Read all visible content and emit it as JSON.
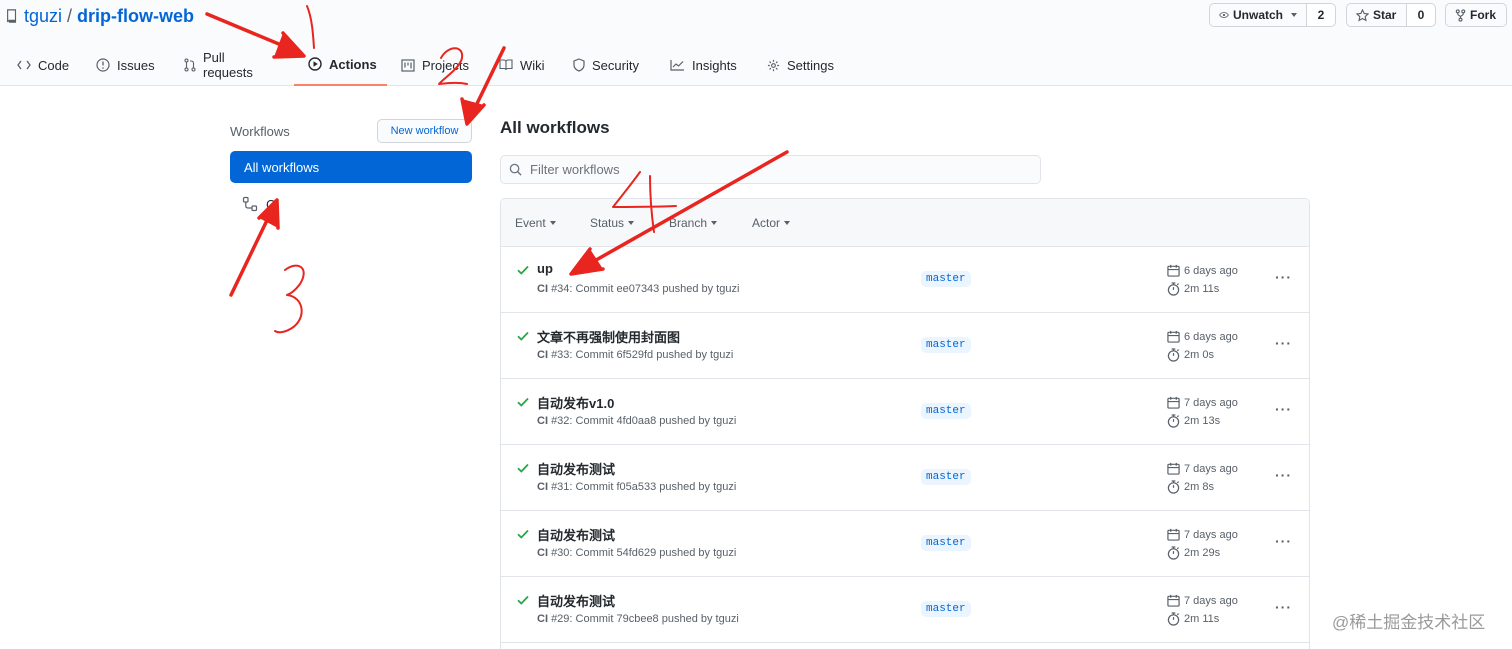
{
  "repo": {
    "owner": "tguzi",
    "separator": "/",
    "name": "drip-flow-web"
  },
  "social": {
    "watch_label": "Unwatch",
    "watch_count": "2",
    "star_label": "Star",
    "star_count": "0",
    "fork_label": "Fork"
  },
  "tabs": [
    {
      "label": "Code",
      "icon": "code-icon"
    },
    {
      "label": "Issues",
      "icon": "issue-icon"
    },
    {
      "label": "Pull requests",
      "icon": "pull-request-icon"
    },
    {
      "label": "Actions",
      "icon": "play-icon",
      "active": true
    },
    {
      "label": "Projects",
      "icon": "project-icon"
    },
    {
      "label": "Wiki",
      "icon": "book-icon"
    },
    {
      "label": "Security",
      "icon": "shield-icon"
    },
    {
      "label": "Insights",
      "icon": "graph-icon"
    },
    {
      "label": "Settings",
      "icon": "gear-icon"
    }
  ],
  "sidebar": {
    "heading": "Workflows",
    "new_workflow": "New workflow",
    "items": [
      {
        "label": "All workflows",
        "selected": true
      },
      {
        "label": "CI",
        "icon": "workflow-icon"
      }
    ]
  },
  "main": {
    "title": "All workflows",
    "filter_placeholder": "Filter workflows",
    "filters": [
      "Event",
      "Status",
      "Branch",
      "Actor"
    ],
    "runs": [
      {
        "title": "up",
        "workflow": "CI",
        "meta": "#34: Commit ee07343 pushed by tguzi",
        "branch": "master",
        "date": "6 days ago",
        "duration": "2m 11s"
      },
      {
        "title": "文章不再强制使用封面图",
        "workflow": "CI",
        "meta": "#33: Commit 6f529fd pushed by tguzi",
        "branch": "master",
        "date": "6 days ago",
        "duration": "2m 0s"
      },
      {
        "title": "自动发布v1.0",
        "workflow": "CI",
        "meta": "#32: Commit 4fd0aa8 pushed by tguzi",
        "branch": "master",
        "date": "7 days ago",
        "duration": "2m 13s"
      },
      {
        "title": "自动发布测试",
        "workflow": "CI",
        "meta": "#31: Commit f05a533 pushed by tguzi",
        "branch": "master",
        "date": "7 days ago",
        "duration": "2m 8s"
      },
      {
        "title": "自动发布测试",
        "workflow": "CI",
        "meta": "#30: Commit 54fd629 pushed by tguzi",
        "branch": "master",
        "date": "7 days ago",
        "duration": "2m 29s"
      },
      {
        "title": "自动发布测试",
        "workflow": "CI",
        "meta": "#29: Commit 79cbee8 pushed by tguzi",
        "branch": "master",
        "date": "7 days ago",
        "duration": "2m 11s"
      }
    ]
  },
  "watermark": "@稀土掘金技术社区",
  "colors": {
    "link": "#0366d6",
    "success": "#28a745",
    "annotation": "#e8251f",
    "active_tab_border": "#f9826c"
  }
}
